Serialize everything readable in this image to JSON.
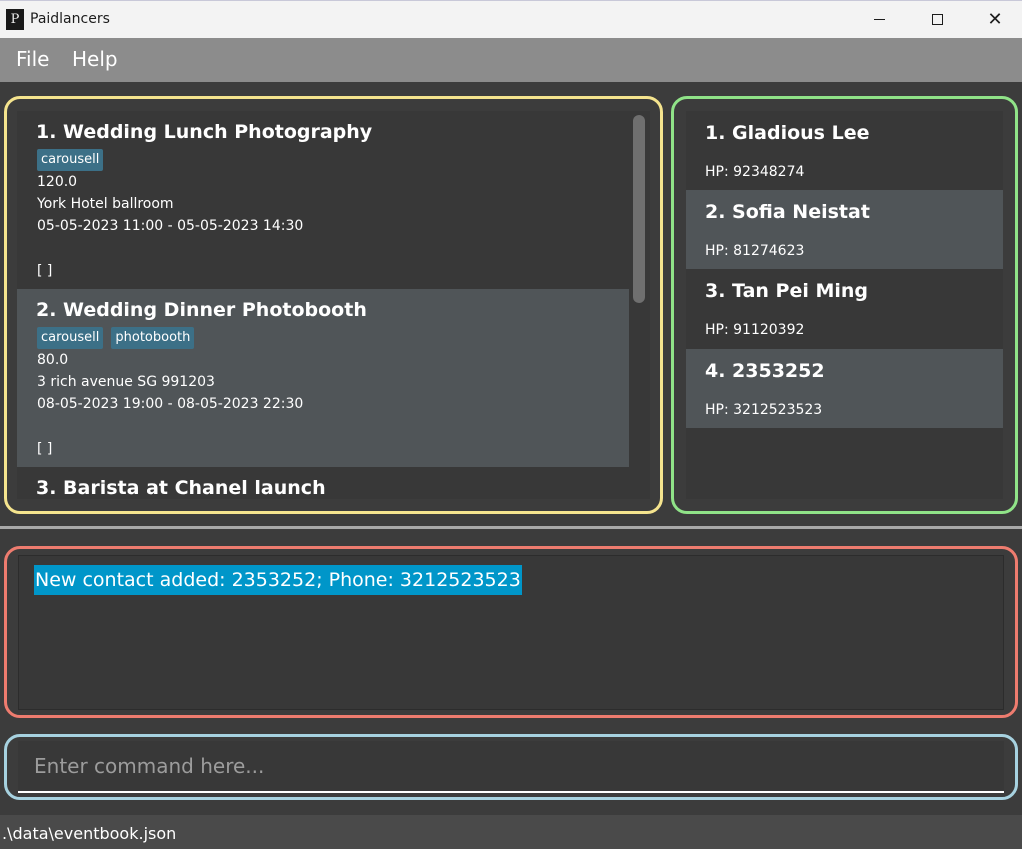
{
  "window": {
    "title": "Paidlancers",
    "logo_glyph": "P"
  },
  "menu": {
    "file_label": "File",
    "help_label": "Help"
  },
  "events": [
    {
      "title": "1.  Wedding Lunch Photography",
      "tags": [
        "carousell"
      ],
      "rate": "120.0",
      "address": "York Hotel ballroom",
      "timing": "05-05-2023 11:00 - 05-05-2023 14:30",
      "contacts": "[ ]"
    },
    {
      "title": "2.  Wedding Dinner Photobooth",
      "tags": [
        "carousell",
        "photobooth"
      ],
      "rate": "80.0",
      "address": "3 rich avenue SG 991203",
      "timing": "08-05-2023 19:00 - 08-05-2023 22:30",
      "contacts": "[ ]"
    },
    {
      "title": "3.  Barista at Chanel launch"
    }
  ],
  "contacts": [
    {
      "name": "1. Gladious Lee",
      "phone": "HP: 92348274"
    },
    {
      "name": "2. Sofia Neistat",
      "phone": "HP: 81274623"
    },
    {
      "name": "3. Tan Pei Ming",
      "phone": "HP: 91120392"
    },
    {
      "name": "4. 2353252",
      "phone": "HP: 3212523523"
    }
  ],
  "result": {
    "message": "New contact added: 2353252; Phone: 3212523523"
  },
  "command": {
    "value": "",
    "placeholder": "Enter command here..."
  },
  "status": {
    "file_path": ".\\data\\eventbook.json"
  },
  "colors": {
    "events_border": "#f5e48e",
    "contacts_border": "#90e388",
    "result_border": "#ee7c6f",
    "command_border": "#a7d2e0",
    "tag_bg": "#3c7087",
    "selection": "#0096c9"
  },
  "icons": {
    "minimize": "minimize-icon",
    "maximize": "maximize-icon",
    "close": "close-icon"
  }
}
